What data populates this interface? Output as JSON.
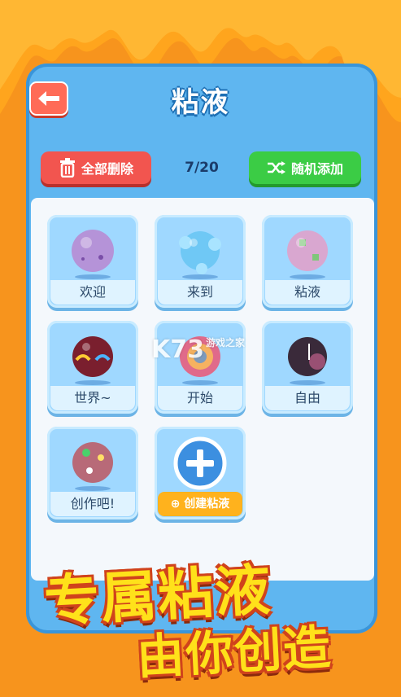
{
  "header": {
    "title": "粘液",
    "back_icon": "back-arrow-icon"
  },
  "toolbar": {
    "clear_label": "全部删除",
    "counter": "7/20",
    "random_label": "随机添加",
    "clear_icon": "trash-icon",
    "random_icon": "shuffle-icon"
  },
  "slimes": [
    {
      "label": "欢迎",
      "color": "#b593d8"
    },
    {
      "label": "来到",
      "color": "#6fc8f5"
    },
    {
      "label": "粘液",
      "color": "#d9a7d0"
    },
    {
      "label": "世界~",
      "color": "#7a1f2e"
    },
    {
      "label": "开始",
      "color": "#e06a8a"
    },
    {
      "label": "自由",
      "color": "#3a2a3a"
    },
    {
      "label": "创作吧!",
      "color": "#b86a78"
    }
  ],
  "create": {
    "label": "创建粘液",
    "icon": "plus-icon"
  },
  "watermark": {
    "text": "K73",
    "sub": "游戏之家"
  },
  "slogan": {
    "line1": "专属粘液",
    "line2": "由你创造"
  },
  "colors": {
    "background": "#f7941d",
    "panel": "#5fb6f0",
    "clear_button": "#f2554f",
    "random_button": "#3bcc45",
    "create_button": "#ffb21d"
  }
}
